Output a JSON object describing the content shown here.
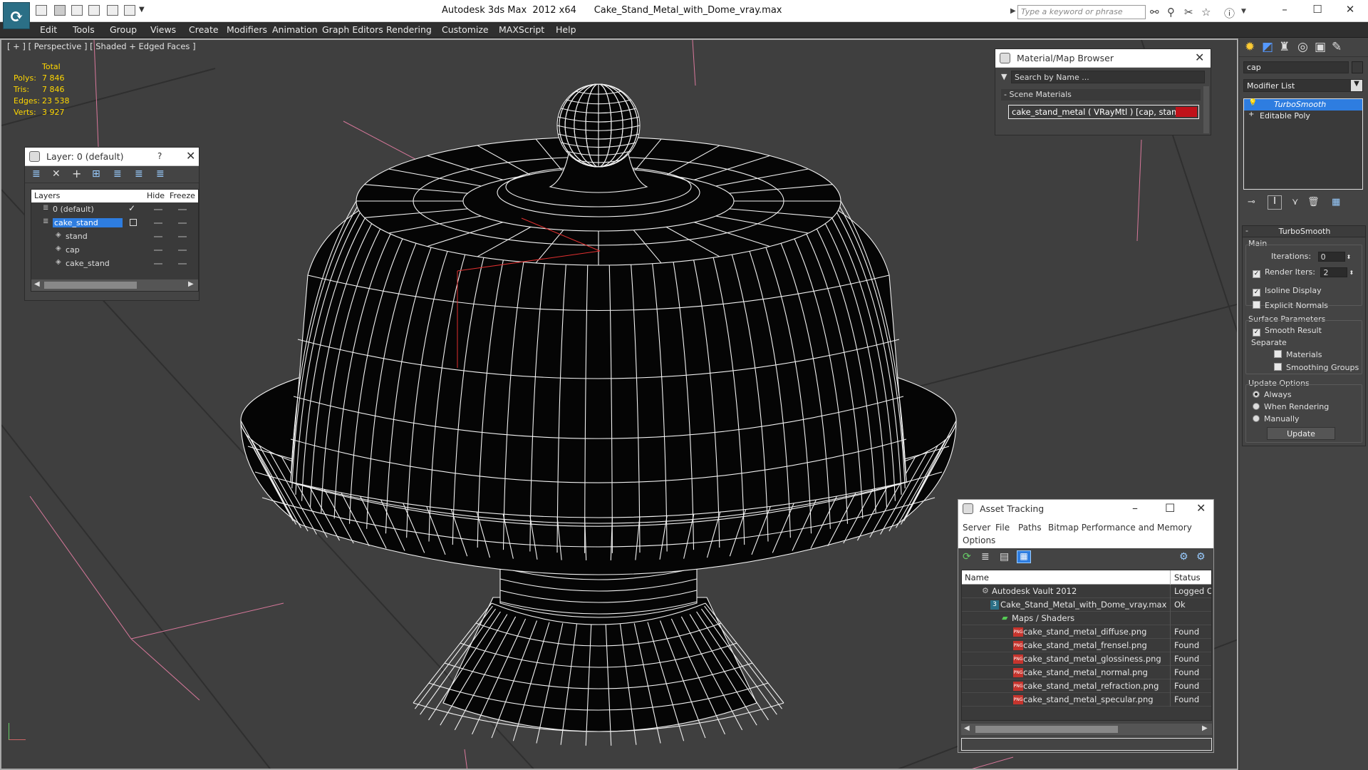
{
  "window": {
    "app_title": "Autodesk 3ds Max  2012 x64",
    "file_title": "Cake_Stand_Metal_with_Dome_vray.max",
    "search_placeholder": "Type a keyword or phrase"
  },
  "menu": [
    "Edit",
    "Tools",
    "Group",
    "Views",
    "Create",
    "Modifiers",
    "Animation",
    "Graph Editors",
    "Rendering",
    "Customize",
    "MAXScript",
    "Help"
  ],
  "viewport": {
    "label": "[ + ] [ Perspective ] [ Shaded + Edged Faces ]",
    "stats": {
      "header": "Total",
      "rows": [
        {
          "label": "Polys:",
          "value": "7 846"
        },
        {
          "label": "Tris:",
          "value": "7 846"
        },
        {
          "label": "Edges:",
          "value": "23 538"
        },
        {
          "label": "Verts:",
          "value": "3 927"
        }
      ]
    }
  },
  "layer_window": {
    "title": "Layer: 0 (default)",
    "help": "?",
    "columns": [
      "Layers",
      "Hide",
      "Freeze"
    ],
    "rows": [
      {
        "name": "0 (default)",
        "checked": true,
        "selected": false,
        "indent": 0
      },
      {
        "name": "cake_stand",
        "checked": false,
        "selected": true,
        "indent": 0
      },
      {
        "name": "stand",
        "checked": false,
        "selected": false,
        "indent": 1
      },
      {
        "name": "cap",
        "checked": false,
        "selected": false,
        "indent": 1
      },
      {
        "name": "cake_stand",
        "checked": false,
        "selected": false,
        "indent": 1
      }
    ]
  },
  "material_browser": {
    "title": "Material/Map Browser",
    "search_placeholder": "Search by Name ...",
    "section": "- Scene Materials",
    "item": "cake_stand_metal  ( VRayMtl )  [cap, stand]",
    "swatch_color": "#c0121a"
  },
  "asset_tracking": {
    "title": "Asset Tracking",
    "menu1": [
      "Server",
      "File",
      "Paths",
      "Bitmap Performance and Memory"
    ],
    "menu2": [
      "Options"
    ],
    "columns": [
      "Name",
      "Status"
    ],
    "rows": [
      {
        "name": "Autodesk Vault 2012",
        "status": "Logged O",
        "indent": 28,
        "icon": "vault"
      },
      {
        "name": "Cake_Stand_Metal_with_Dome_vray.max",
        "status": "Ok",
        "indent": 40,
        "icon": "max"
      },
      {
        "name": "Maps / Shaders",
        "status": "",
        "indent": 56,
        "icon": "maps"
      },
      {
        "name": "cake_stand_metal_diffuse.png",
        "status": "Found",
        "indent": 72,
        "icon": "png"
      },
      {
        "name": "cake_stand_metal_frensel.png",
        "status": "Found",
        "indent": 72,
        "icon": "png"
      },
      {
        "name": "cake_stand_metal_glossiness.png",
        "status": "Found",
        "indent": 72,
        "icon": "png"
      },
      {
        "name": "cake_stand_metal_normal.png",
        "status": "Found",
        "indent": 72,
        "icon": "png"
      },
      {
        "name": "cake_stand_metal_refraction.png",
        "status": "Found",
        "indent": 72,
        "icon": "png"
      },
      {
        "name": "cake_stand_metal_specular.png",
        "status": "Found",
        "indent": 72,
        "icon": "png"
      }
    ],
    "png_icon_text": "PNG"
  },
  "command_panel": {
    "object_name": "cap",
    "modifier_list_label": "Modifier List",
    "stack": [
      {
        "name": "TurboSmooth",
        "selected": true
      },
      {
        "name": "Editable Poly",
        "selected": false
      }
    ],
    "rollout_title": "TurboSmooth",
    "main_label": "Main",
    "iterations_label": "Iterations:",
    "iterations_value": "0",
    "render_iters_label": "Render Iters:",
    "render_iters_value": "2",
    "isoline_label": "Isoline Display",
    "explicit_label": "Explicit Normals",
    "surface_label": "Surface Parameters",
    "smooth_label": "Smooth Result",
    "separate_label": "Separate",
    "materials_label": "Materials",
    "smoothing_groups_label": "Smoothing Groups",
    "update_options_label": "Update Options",
    "always_label": "Always",
    "when_rendering_label": "When Rendering",
    "manually_label": "Manually",
    "update_button": "Update"
  },
  "colors": {
    "selection": "#2e7de0",
    "axis_lines": "#d8789b",
    "wire": "#f2f2f2"
  }
}
